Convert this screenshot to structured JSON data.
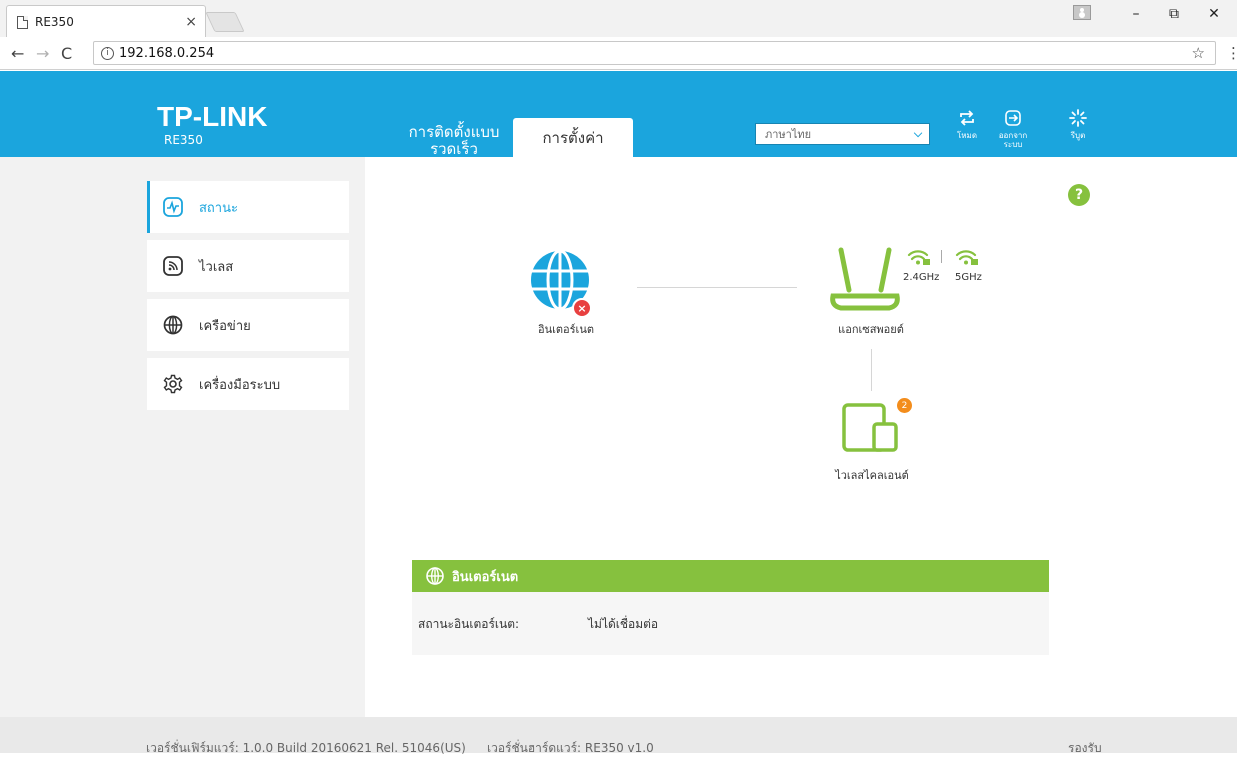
{
  "browser": {
    "tab_title": "RE350",
    "tab_close": "×",
    "url": "192.168.0.254",
    "controls": {
      "minimize": "–",
      "restore": "⧉",
      "close": "✕"
    }
  },
  "header": {
    "brand": "TP-LINK",
    "model": "RE350",
    "nav": {
      "quick_setup": "การติดตั้งแบบรวดเร็ว",
      "settings": "การตั้งค่า"
    },
    "language": "ภาษาไทย",
    "buttons": {
      "mode": "โหมด",
      "logout": "ออกจากระบบ",
      "reboot": "รีบูต"
    }
  },
  "sidebar": {
    "items": [
      {
        "label": "สถานะ",
        "icon": "status-icon",
        "active": true
      },
      {
        "label": "ไวเลส",
        "icon": "wireless-icon",
        "active": false
      },
      {
        "label": "เครือข่าย",
        "icon": "network-icon",
        "active": false
      },
      {
        "label": "เครื่องมือระบบ",
        "icon": "system-tools-icon",
        "active": false
      }
    ]
  },
  "topology": {
    "help": "?",
    "internet_label": "อินเตอร์เนต",
    "internet_status_badge": "×",
    "ap_label": "แอกเซสพอยต์",
    "band_24": "2.4GHz",
    "band_5": "5GHz",
    "clients_label": "ไวเลสไคลเอนต์",
    "clients_count": "2"
  },
  "internet_panel": {
    "title": "อินเตอร์เนต",
    "row_label": "สถานะอินเตอร์เนต:",
    "row_value": "ไม่ได้เชื่อมต่อ"
  },
  "footer": {
    "firmware": "เวอร์ชั่นเฟิร์มแวร์: 1.0.0 Build 20160621 Rel. 51046(US)",
    "hardware": "เวอร์ชั่นฮาร์ดแวร์: RE350 v1.0",
    "support": "รองรับ"
  },
  "colors": {
    "brand_blue": "#1ba5dd",
    "green": "#86c13e",
    "error_red": "#e84040",
    "badge_orange": "#f38d1c"
  }
}
